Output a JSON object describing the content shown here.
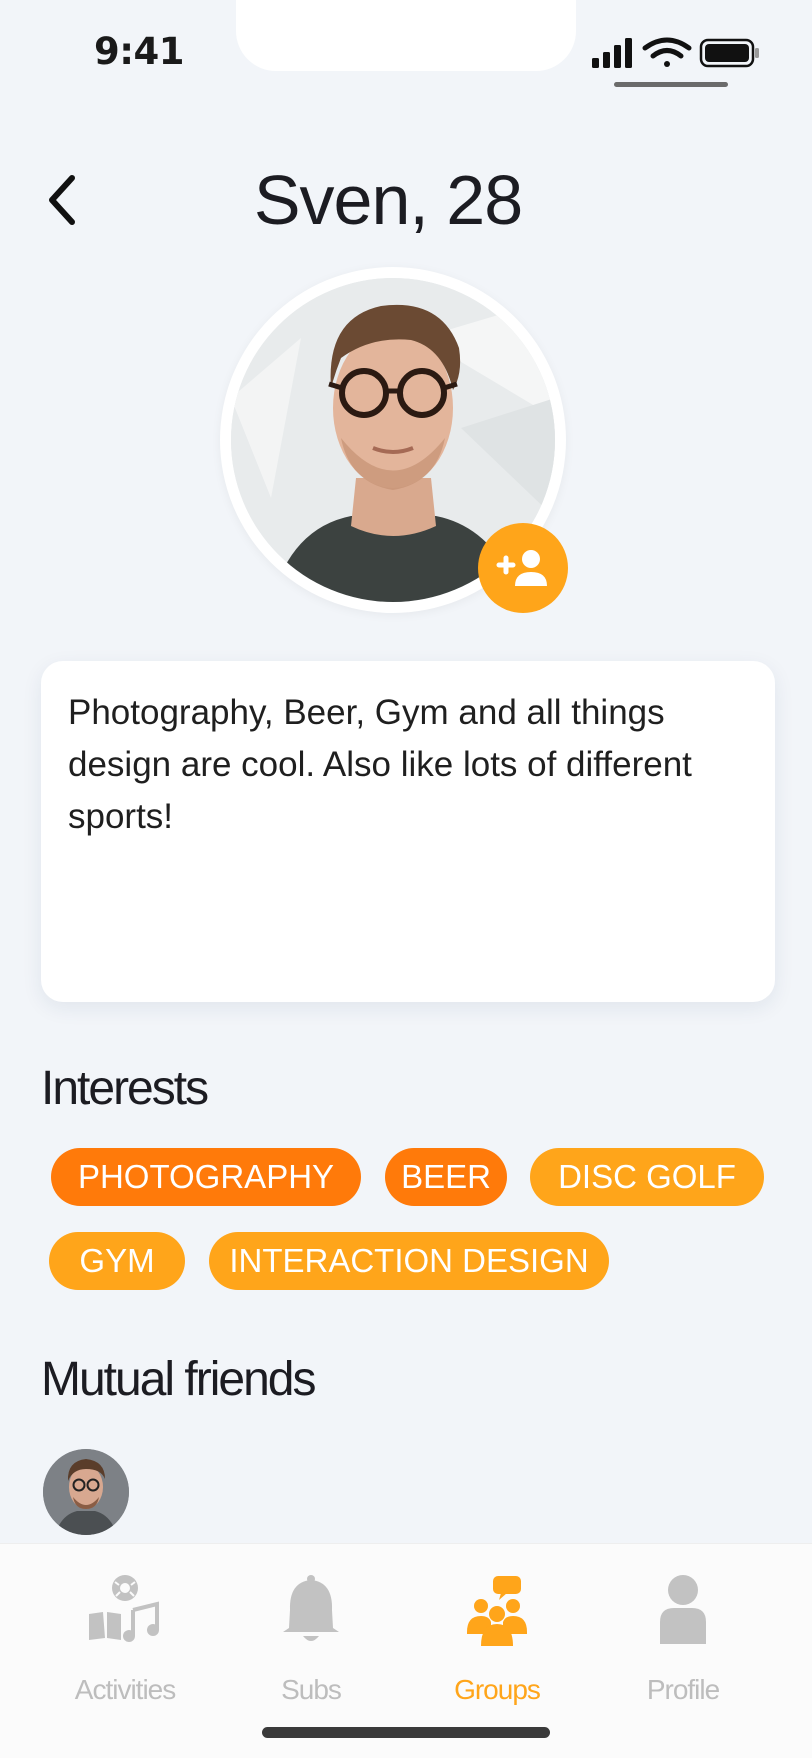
{
  "status_bar": {
    "time": "9:41"
  },
  "header": {
    "title": "Sven, 28"
  },
  "bio": "Photography, Beer, Gym and all things design are cool. Also like lots of different sports!",
  "interests": {
    "title": "Interests",
    "chips": [
      {
        "label": "PHOTOGRAPHY",
        "style": "dark"
      },
      {
        "label": "BEER",
        "style": "dark"
      },
      {
        "label": "DISC GOLF",
        "style": "light"
      },
      {
        "label": "GYM",
        "style": "light"
      },
      {
        "label": "INTERACTION DESIGN",
        "style": "light"
      }
    ]
  },
  "mutual_friends": {
    "title": "Mutual friends",
    "count_shown": 1
  },
  "tabbar": {
    "tabs": [
      {
        "label": "Activities",
        "icon": "activities-icon",
        "active": false
      },
      {
        "label": "Subs",
        "icon": "bell-icon",
        "active": false
      },
      {
        "label": "Groups",
        "icon": "groups-icon",
        "active": true
      },
      {
        "label": "Profile",
        "icon": "profile-icon",
        "active": false
      }
    ]
  },
  "colors": {
    "accent": "#FFA51A",
    "accent_dark": "#FF7A0A",
    "background": "#F2F5F9",
    "inactive_tab": "#BDBDBD"
  }
}
